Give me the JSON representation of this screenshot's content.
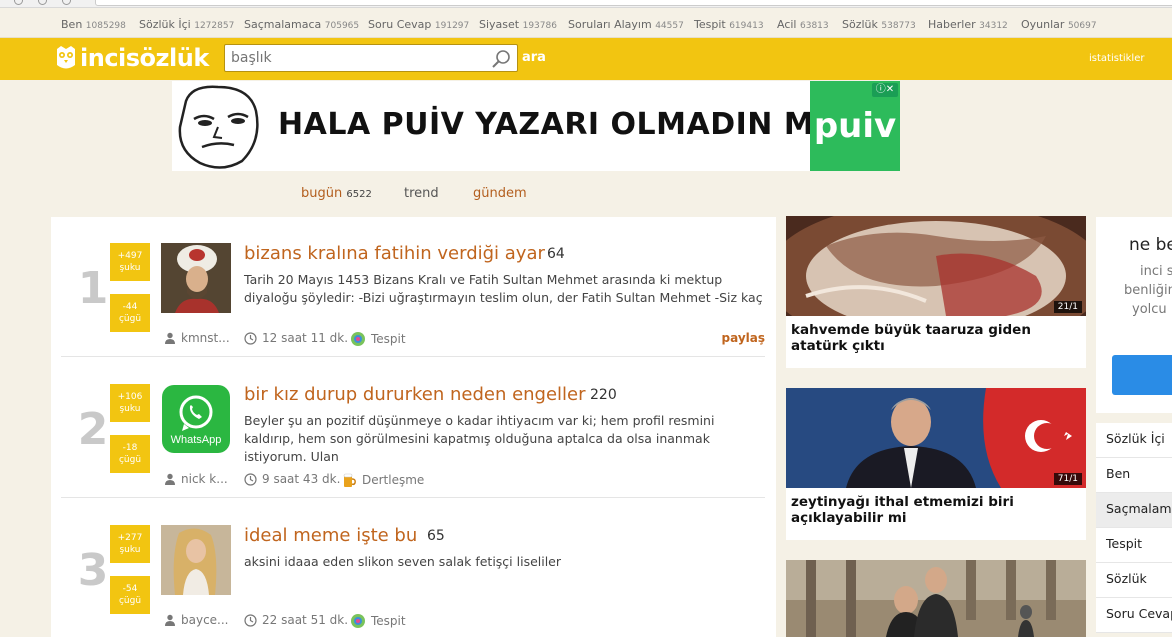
{
  "categories": [
    {
      "label": "Ben",
      "count": "1085298"
    },
    {
      "label": "Sözlük İçi",
      "count": "1272857"
    },
    {
      "label": "Saçmalamaca",
      "count": "705965"
    },
    {
      "label": "Soru Cevap",
      "count": "191297"
    },
    {
      "label": "Siyaset",
      "count": "193786"
    },
    {
      "label": "Soruları Alayım",
      "count": "44557"
    },
    {
      "label": "Tespit",
      "count": "619413"
    },
    {
      "label": "Acil",
      "count": "63813"
    },
    {
      "label": "Sözlük",
      "count": "538773"
    },
    {
      "label": "Haberler",
      "count": "34312"
    },
    {
      "label": "Oyunlar",
      "count": "50697"
    }
  ],
  "header": {
    "logo": "incisözlük",
    "search_placeholder": "başlık",
    "search_button": "ara",
    "stats_link": "istatistikler"
  },
  "ad": {
    "text": "HALA PUİV YAZARI OLMADIN MI?",
    "brand": "puiv"
  },
  "tabs": {
    "today_label": "bugün",
    "today_count": "6522",
    "trend_label": "trend",
    "agenda_label": "gündem"
  },
  "entries": [
    {
      "rank": "1",
      "up": "+497",
      "up_label": "şuku",
      "down": "-44",
      "down_label": "çügü",
      "title": "bizans kralına fatihin verdiği ayar",
      "count": "64",
      "snippet": "Tarih 20 Mayıs 1453 Bizans Kralı ve Fatih Sultan Mehmet arasında ki mektup diyaloğu şöyledir: -Bizi uğraştırmayın teslim olun, der Fatih Sultan Mehmet -Siz kaç",
      "user": "kmnst...",
      "time": "12 saat 11 dk.",
      "category": "Tespit",
      "share": "paylaş"
    },
    {
      "rank": "2",
      "up": "+106",
      "up_label": "şuku",
      "down": "-18",
      "down_label": "çügü",
      "title": "bir kız durup dururken neden engeller",
      "count": "220",
      "snippet": "Beyler şu an pozitif düşünmeye o kadar ihtiyacım var ki; hem profil resmini kaldırıp, hem son görülmesini kapatmış olduğuna aptalca da olsa inanmak istiyorum. Ulan",
      "user": "nick k...",
      "time": "9 saat 43 dk.",
      "category": "Dertleşme",
      "thumb_text": "WhatsApp"
    },
    {
      "rank": "3",
      "up": "+277",
      "up_label": "şuku",
      "down": "-54",
      "down_label": "çügü",
      "title": "ideal meme işte bu",
      "count": "65",
      "snippet": "aksini idaaa eden slikon seven salak fetişçi liseliler",
      "user": "bayce...",
      "time": "22 saat 51 dk.",
      "category": "Tespit"
    }
  ],
  "cards": [
    {
      "badge": "21/1",
      "title": "kahvemde büyük taaruza giden atatürk çıktı"
    },
    {
      "badge": "71/1",
      "title": "zeytinyağı ithal etmemizi biri açıklayabilir mi"
    },
    {
      "badge": "",
      "title": ""
    }
  ],
  "right_box": {
    "heading": "ne be",
    "line1": "inci s",
    "line2": "benliğin",
    "line3": "yolcu"
  },
  "right_list": [
    "Sözlük İçi",
    "Ben",
    "Saçmalama",
    "Tespit",
    "Sözlük",
    "Soru Cevap"
  ],
  "colors": {
    "brand_yellow": "#f2c511",
    "title_orange": "#c0651e",
    "background": "#f5f1e6"
  }
}
